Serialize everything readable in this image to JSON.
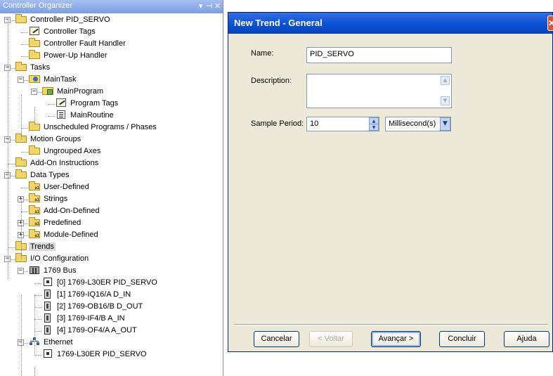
{
  "left_pane": {
    "title": "Controller Organizer",
    "controls": {
      "dropdown": "▾",
      "pin": "⊣",
      "close": "✕"
    },
    "tree": [
      {
        "label": "Controller PID_SERVO",
        "icon": "folder-icon",
        "expander": "−"
      },
      {
        "label": "Controller Tags",
        "icon": "tag-icon"
      },
      {
        "label": "Controller Fault Handler",
        "icon": "folder-icon"
      },
      {
        "label": "Power-Up Handler",
        "icon": "folder-icon"
      },
      {
        "label": "Tasks",
        "icon": "folder-icon",
        "expander": "−"
      },
      {
        "label": "MainTask",
        "icon": "task-icon",
        "expander": "−"
      },
      {
        "label": "MainProgram",
        "icon": "program-icon",
        "expander": "−"
      },
      {
        "label": "Program Tags",
        "icon": "tag-icon"
      },
      {
        "label": "MainRoutine",
        "icon": "routine-icon"
      },
      {
        "label": "Unscheduled Programs / Phases",
        "icon": "folder-icon"
      },
      {
        "label": "Motion Groups",
        "icon": "folder-icon",
        "expander": "−"
      },
      {
        "label": "Ungrouped Axes",
        "icon": "folder-icon"
      },
      {
        "label": "Add-On Instructions",
        "icon": "folder-icon"
      },
      {
        "label": "Data Types",
        "icon": "folder-icon",
        "expander": "−"
      },
      {
        "label": "User-Defined",
        "icon": "datatype-folder-icon"
      },
      {
        "label": "Strings",
        "icon": "datatype-folder-icon",
        "expander": "+"
      },
      {
        "label": "Add-On-Defined",
        "icon": "datatype-folder-icon"
      },
      {
        "label": "Predefined",
        "icon": "datatype-folder-icon",
        "expander": "+"
      },
      {
        "label": "Module-Defined",
        "icon": "datatype-folder-icon",
        "expander": "+"
      },
      {
        "label": "Trends",
        "icon": "folder-icon",
        "selected": true
      },
      {
        "label": "I/O Configuration",
        "icon": "folder-icon",
        "expander": "−"
      },
      {
        "label": "1769 Bus",
        "icon": "bus-icon",
        "expander": "−"
      },
      {
        "label": "[0] 1769-L30ER PID_SERVO",
        "icon": "controller-icon"
      },
      {
        "label": "[1] 1769-IQ16/A D_IN",
        "icon": "module-icon"
      },
      {
        "label": "[2] 1769-OB16/B D_OUT",
        "icon": "module-icon"
      },
      {
        "label": "[3] 1769-IF4/B A_IN",
        "icon": "module-icon"
      },
      {
        "label": "[4] 1769-OF4/A A_OUT",
        "icon": "module-icon"
      },
      {
        "label": "Ethernet",
        "icon": "network-icon",
        "expander": "−"
      },
      {
        "label": "1769-L30ER PID_SERVO",
        "icon": "controller-icon"
      }
    ]
  },
  "dialog": {
    "title": "New Trend - General",
    "name_label": "Name:",
    "name_value": "PID_SERVO",
    "description_label": "Description:",
    "description_value": "",
    "sample_period_label": "Sample Period:",
    "sample_period_value": "10",
    "unit_value": "Millisecond(s)",
    "buttons": {
      "cancel": "Cancelar",
      "back": "< Voltar",
      "next": "Avançar >",
      "finish": "Concluir",
      "help": "Ajuda"
    }
  }
}
